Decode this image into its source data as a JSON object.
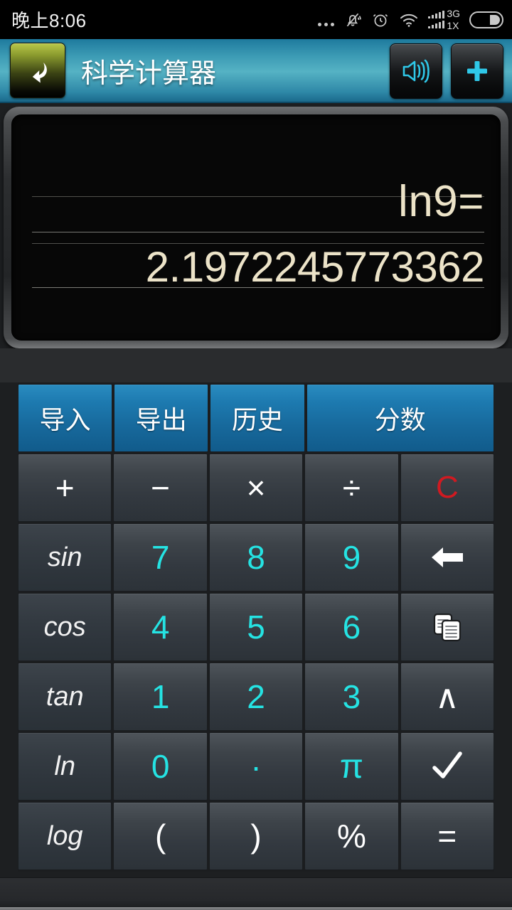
{
  "status_bar": {
    "time": "晚上8:06",
    "icons": [
      "ellipsis-icon",
      "mute-bell-icon",
      "alarm-clock-icon",
      "wifi-icon",
      "signal-bars-icon",
      "battery-icon"
    ],
    "network_primary": "3G",
    "network_secondary": "1X"
  },
  "title_bar": {
    "title": "科学计算器",
    "back_icon": "back-arrow-icon",
    "sound_icon": "speaker-icon",
    "add_icon": "plus-icon",
    "accent_color": "#3d9cb5"
  },
  "display": {
    "expression": "ln9=",
    "result": "2.1972245773362",
    "text_color": "#ece3c8"
  },
  "keypad": {
    "function_row": [
      {
        "label": "导入",
        "name": "import-button"
      },
      {
        "label": "导出",
        "name": "export-button"
      },
      {
        "label": "历史",
        "name": "history-button"
      },
      {
        "label": "分数",
        "name": "fraction-button"
      }
    ],
    "rows": [
      [
        {
          "label": "+",
          "name": "add-button"
        },
        {
          "label": "−",
          "name": "subtract-button"
        },
        {
          "label": "×",
          "name": "multiply-button"
        },
        {
          "label": "÷",
          "name": "divide-button"
        },
        {
          "label": "C",
          "name": "clear-button"
        }
      ],
      [
        {
          "label": "sin",
          "name": "sin-button"
        },
        {
          "label": "7",
          "name": "digit-7-button"
        },
        {
          "label": "8",
          "name": "digit-8-button"
        },
        {
          "label": "9",
          "name": "digit-9-button"
        },
        {
          "label": "",
          "name": "backspace-button"
        }
      ],
      [
        {
          "label": "cos",
          "name": "cos-button"
        },
        {
          "label": "4",
          "name": "digit-4-button"
        },
        {
          "label": "5",
          "name": "digit-5-button"
        },
        {
          "label": "6",
          "name": "digit-6-button"
        },
        {
          "label": "",
          "name": "copy-button"
        }
      ],
      [
        {
          "label": "tan",
          "name": "tan-button"
        },
        {
          "label": "1",
          "name": "digit-1-button"
        },
        {
          "label": "2",
          "name": "digit-2-button"
        },
        {
          "label": "3",
          "name": "digit-3-button"
        },
        {
          "label": "∧",
          "name": "power-button"
        }
      ],
      [
        {
          "label": "ln",
          "name": "ln-button"
        },
        {
          "label": "0",
          "name": "digit-0-button"
        },
        {
          "label": "·",
          "name": "decimal-point-button"
        },
        {
          "label": "π",
          "name": "pi-button"
        },
        {
          "label": "",
          "name": "sqrt-button"
        }
      ],
      [
        {
          "label": "log",
          "name": "log-button"
        },
        {
          "label": "(",
          "name": "left-paren-button"
        },
        {
          "label": ")",
          "name": "right-paren-button"
        },
        {
          "label": "%",
          "name": "percent-button"
        },
        {
          "label": "=",
          "name": "equals-button"
        }
      ]
    ],
    "colors": {
      "digit": "#25e3e3",
      "clear": "#d01a21",
      "function_row": "#1d7ab0"
    }
  }
}
